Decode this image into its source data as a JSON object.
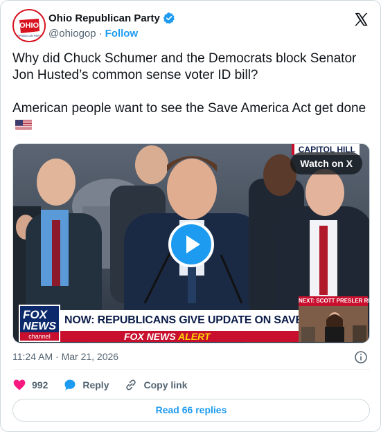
{
  "account": {
    "name": "Ohio Republican Party",
    "handle": "@ohiogop",
    "separator": "·",
    "follow_label": "Follow",
    "avatar_text": "OHIO",
    "avatar_subtext": "REPUBLICAN PARTY"
  },
  "tweet": {
    "text": "Why did Chuck Schumer and the Democrats block Senator Jon Husted’s common sense voter ID bill?\n\nAmerican people want to see the Save America Act get done",
    "flag_icon": "us-flag-icon"
  },
  "media": {
    "watch_label": "Watch on X",
    "bug_text": "CAPITOL HILL",
    "chyron": "NOW: REPUBLICANS GIVE UPDATE ON SAVE AMERICA ACT",
    "alert_fox": "FOX NEWS",
    "alert_word": "ALERT",
    "fox_line1": "FOX",
    "fox_line2": "NEWS",
    "fox_line3": "channel",
    "next_label": "NEXT: SCOTT PRESLER REACTS"
  },
  "meta": {
    "time": "11:24 AM",
    "separator": "·",
    "date": "Mar 21, 2026"
  },
  "actions": {
    "likes": "992",
    "reply_label": "Reply",
    "copy_link_label": "Copy link"
  },
  "read_replies_label": "Read 66 replies",
  "colors": {
    "accent": "#1d9bf0",
    "like": "#f91880",
    "fox_red": "#c8102e",
    "fox_blue": "#0c2a6b"
  }
}
